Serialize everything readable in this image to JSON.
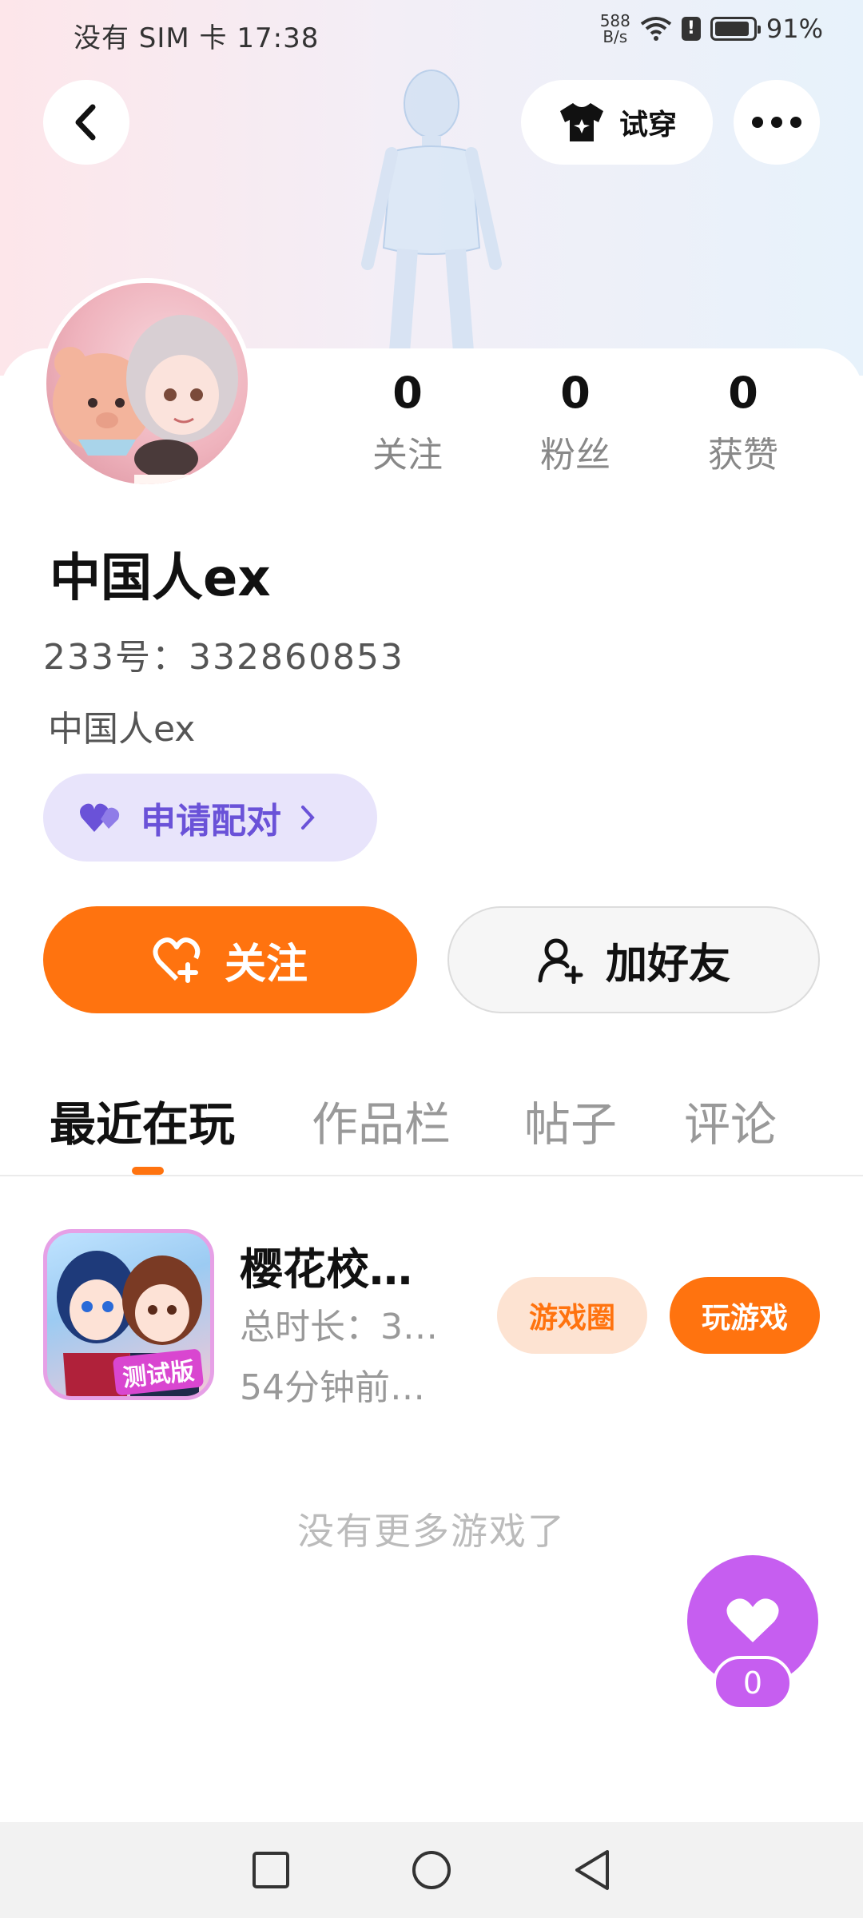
{
  "status_bar": {
    "left_text": "没有 SIM 卡 17:38",
    "net_speed_value": "588",
    "net_speed_unit": "B/s",
    "battery": "91%"
  },
  "header": {
    "tryon_label": "试穿"
  },
  "profile": {
    "stats": [
      {
        "value": "0",
        "label": "关注"
      },
      {
        "value": "0",
        "label": "粉丝"
      },
      {
        "value": "0",
        "label": "获赞"
      }
    ],
    "username": "中国人ex",
    "user_id": "233号：332860853",
    "bio": "中国人ex",
    "pair_label": "申请配对"
  },
  "actions": {
    "follow_label": "关注",
    "add_friend_label": "加好友"
  },
  "tabs": [
    {
      "label": "最近在玩",
      "active": true
    },
    {
      "label": "作品栏",
      "active": false
    },
    {
      "label": "帖子",
      "active": false
    },
    {
      "label": "评论",
      "active": false
    }
  ],
  "games": [
    {
      "name": "樱花校…",
      "total_time": "总时长：3…",
      "last_played": "54分钟前…",
      "tag": "测试版",
      "circle_label": "游戏圈",
      "play_label": "玩游戏"
    }
  ],
  "empty_text": "没有更多游戏了",
  "like_fab": {
    "count": "0"
  },
  "colors": {
    "accent_orange": "#ff730f",
    "pair_purple": "#6a52d8",
    "pair_bg": "#e8e4fb",
    "like_purple": "#c65ef0"
  }
}
